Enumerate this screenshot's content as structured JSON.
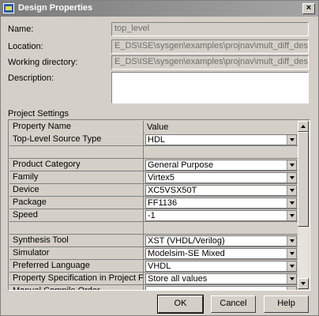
{
  "window": {
    "title": "Design Properties",
    "icon": "app-icon",
    "close_label": "×"
  },
  "fields": {
    "name_label": "Name:",
    "name_value": "top_level",
    "location_label": "Location:",
    "location_value": "E_DS\\ISE\\sysgen\\examples\\projnav\\mult_diff_designs\\top_level",
    "working_dir_label": "Working directory:",
    "working_dir_value": "E_DS\\ISE\\sysgen\\examples\\projnav\\mult_diff_designs\\top_level",
    "description_label": "Description:",
    "description_value": ""
  },
  "settings": {
    "section_label": "Project Settings",
    "header": {
      "property": "Property Name",
      "value": "Value"
    },
    "rows": [
      {
        "property": "Top-Level Source Type",
        "value": "HDL"
      },
      {
        "property": "",
        "value": "",
        "empty": true
      },
      {
        "property": "Product Category",
        "value": "General Purpose"
      },
      {
        "property": "Family",
        "value": "Virtex5"
      },
      {
        "property": "Device",
        "value": "XC5VSX50T"
      },
      {
        "property": "Package",
        "value": "FF1136"
      },
      {
        "property": "Speed",
        "value": "-1"
      },
      {
        "property": "",
        "value": "",
        "empty": true
      },
      {
        "property": "Synthesis Tool",
        "value": "XST (VHDL/Verilog)"
      },
      {
        "property": "Simulator",
        "value": "Modelsim-SE Mixed"
      },
      {
        "property": "Preferred Language",
        "value": "VHDL"
      },
      {
        "property": "Property Specification in Project File",
        "value": "Store all values"
      },
      {
        "property": "Manual Compile Order",
        "value": ""
      }
    ]
  },
  "buttons": {
    "ok": "OK",
    "cancel": "Cancel",
    "help": "Help"
  }
}
